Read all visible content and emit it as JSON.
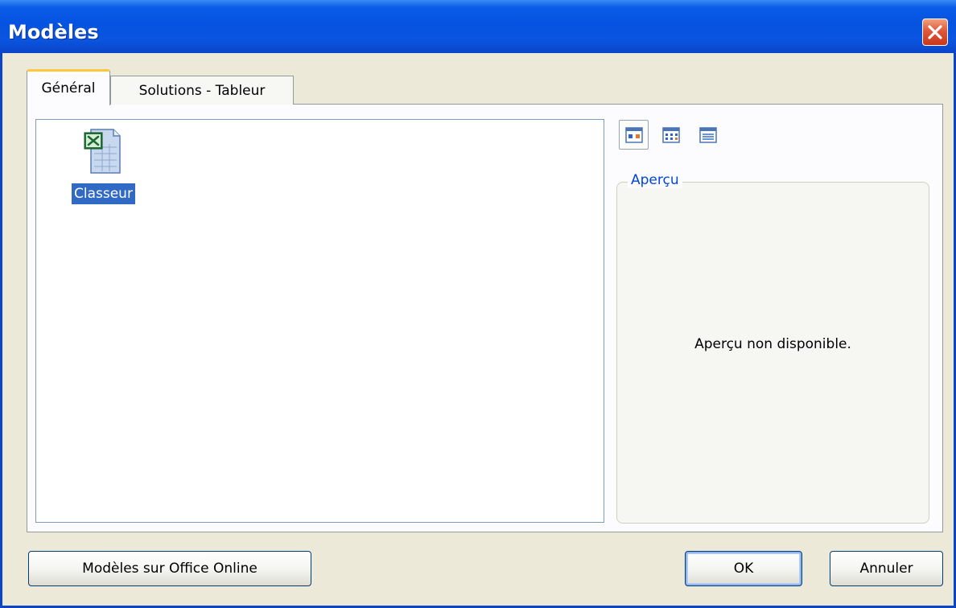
{
  "window": {
    "title": "Modèles"
  },
  "tabs": [
    {
      "label": "Général",
      "active": true
    },
    {
      "label": "Solutions - Tableur",
      "active": false
    }
  ],
  "templates": [
    {
      "label": "Classeur",
      "icon": "excel-workbook-icon",
      "selected": true
    }
  ],
  "view_buttons": [
    {
      "icon": "large-icons-view-icon",
      "active": true
    },
    {
      "icon": "list-view-icon",
      "active": false
    },
    {
      "icon": "details-view-icon",
      "active": false
    }
  ],
  "preview": {
    "label": "Aperçu",
    "message": "Aperçu non disponible."
  },
  "buttons": {
    "office_online": "Modèles sur Office Online",
    "ok": "OK",
    "cancel": "Annuler"
  },
  "colors": {
    "titlebar": "#0553e0",
    "selection": "#316ac5",
    "close": "#e0583a",
    "tab_highlight": "#ffc83c"
  }
}
